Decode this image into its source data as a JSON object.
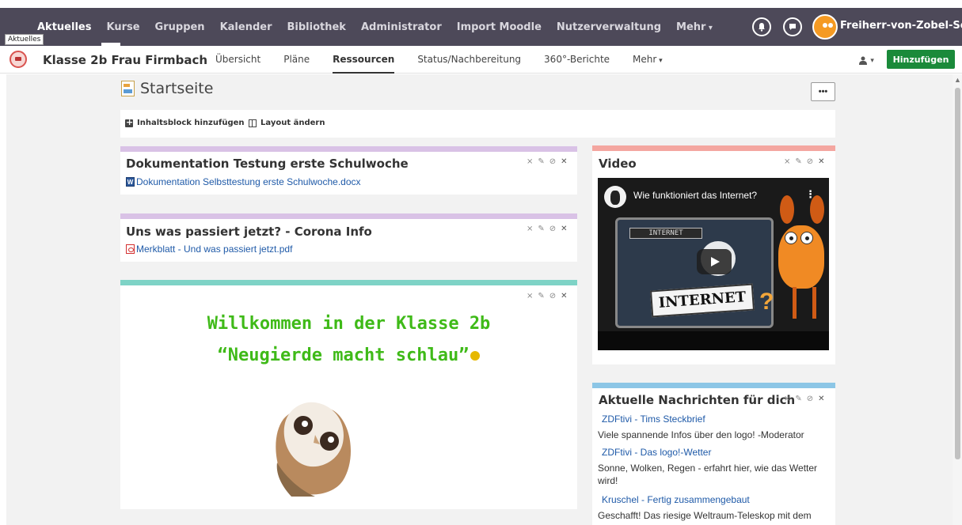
{
  "topnav": {
    "tooltip": "Aktuelles",
    "items": [
      "Aktuelles",
      "Kurse",
      "Gruppen",
      "Kalender",
      "Bibliothek",
      "Administrator",
      "Import Moodle",
      "Nutzerverwaltung"
    ],
    "more": "Mehr",
    "username": "Freiherr-von-Zobel-Sch..."
  },
  "subbar": {
    "course_title": "Klasse 2b Frau Firmbach",
    "items": [
      "Übersicht",
      "Pläne",
      "Ressourcen",
      "Status/Nachbereitung",
      "360°-Berichte"
    ],
    "more": "Mehr",
    "user_menu": "▾",
    "add_button": "Hinzufügen"
  },
  "page": {
    "title": "Startseite",
    "dots_button": "•••",
    "add_block": "Inhaltsblock hinzufügen",
    "change_layout": "Layout ändern"
  },
  "blocks": {
    "doc": {
      "title": "Dokumentation Testung erste Schulwoche",
      "file": "Dokumentation Selbsttestung erste Schulwoche.docx",
      "file_icon": "W"
    },
    "corona": {
      "title": "Uns was passiert jetzt? - Corona Info",
      "file": "Merkblatt - Und was passiert jetzt.pdf"
    },
    "welcome": {
      "line1": "Willkommen in der Klasse 2b",
      "line2": "“Neugierde macht schlau”"
    },
    "video": {
      "title": "Video",
      "video_title": "Wie funktioniert das Internet?",
      "sign_small": "INTERNET",
      "sign_big": "INTERNET"
    },
    "news": {
      "title": "Aktuelle Nachrichten für dich",
      "items": [
        {
          "title": "ZDFtivi - Tims Steckbrief",
          "text": "Viele spannende Infos über den logo! -Moderator"
        },
        {
          "title": "ZDFtivi - Das logo!-Wetter",
          "text": "Sonne, Wolken, Regen - erfahrt hier, wie das Wetter wird!"
        },
        {
          "title": "Kruschel - Fertig zusammengebaut",
          "text": "Geschafft! Das riesige Weltraum-Teleskop mit dem"
        }
      ]
    }
  },
  "controls": {
    "collapse": "⨯",
    "edit": "✎",
    "link": "⊘",
    "close": "✕"
  },
  "colors": {
    "topbar": "#4d4959",
    "accent_green": "#1a8a3a",
    "bar_purple": "#d9c2e6",
    "bar_teal": "#7ed3c6",
    "bar_red": "#f4a6a0",
    "bar_blue": "#8cc6e6",
    "welcome_green": "#3fba18",
    "link_blue": "#1f5aa8"
  },
  "icons": {
    "bell": "bell-icon",
    "chat": "chat-icon",
    "avatar": "avatar",
    "course": "graduation-cap-icon",
    "user": "user-icon",
    "page": "page-icon"
  }
}
